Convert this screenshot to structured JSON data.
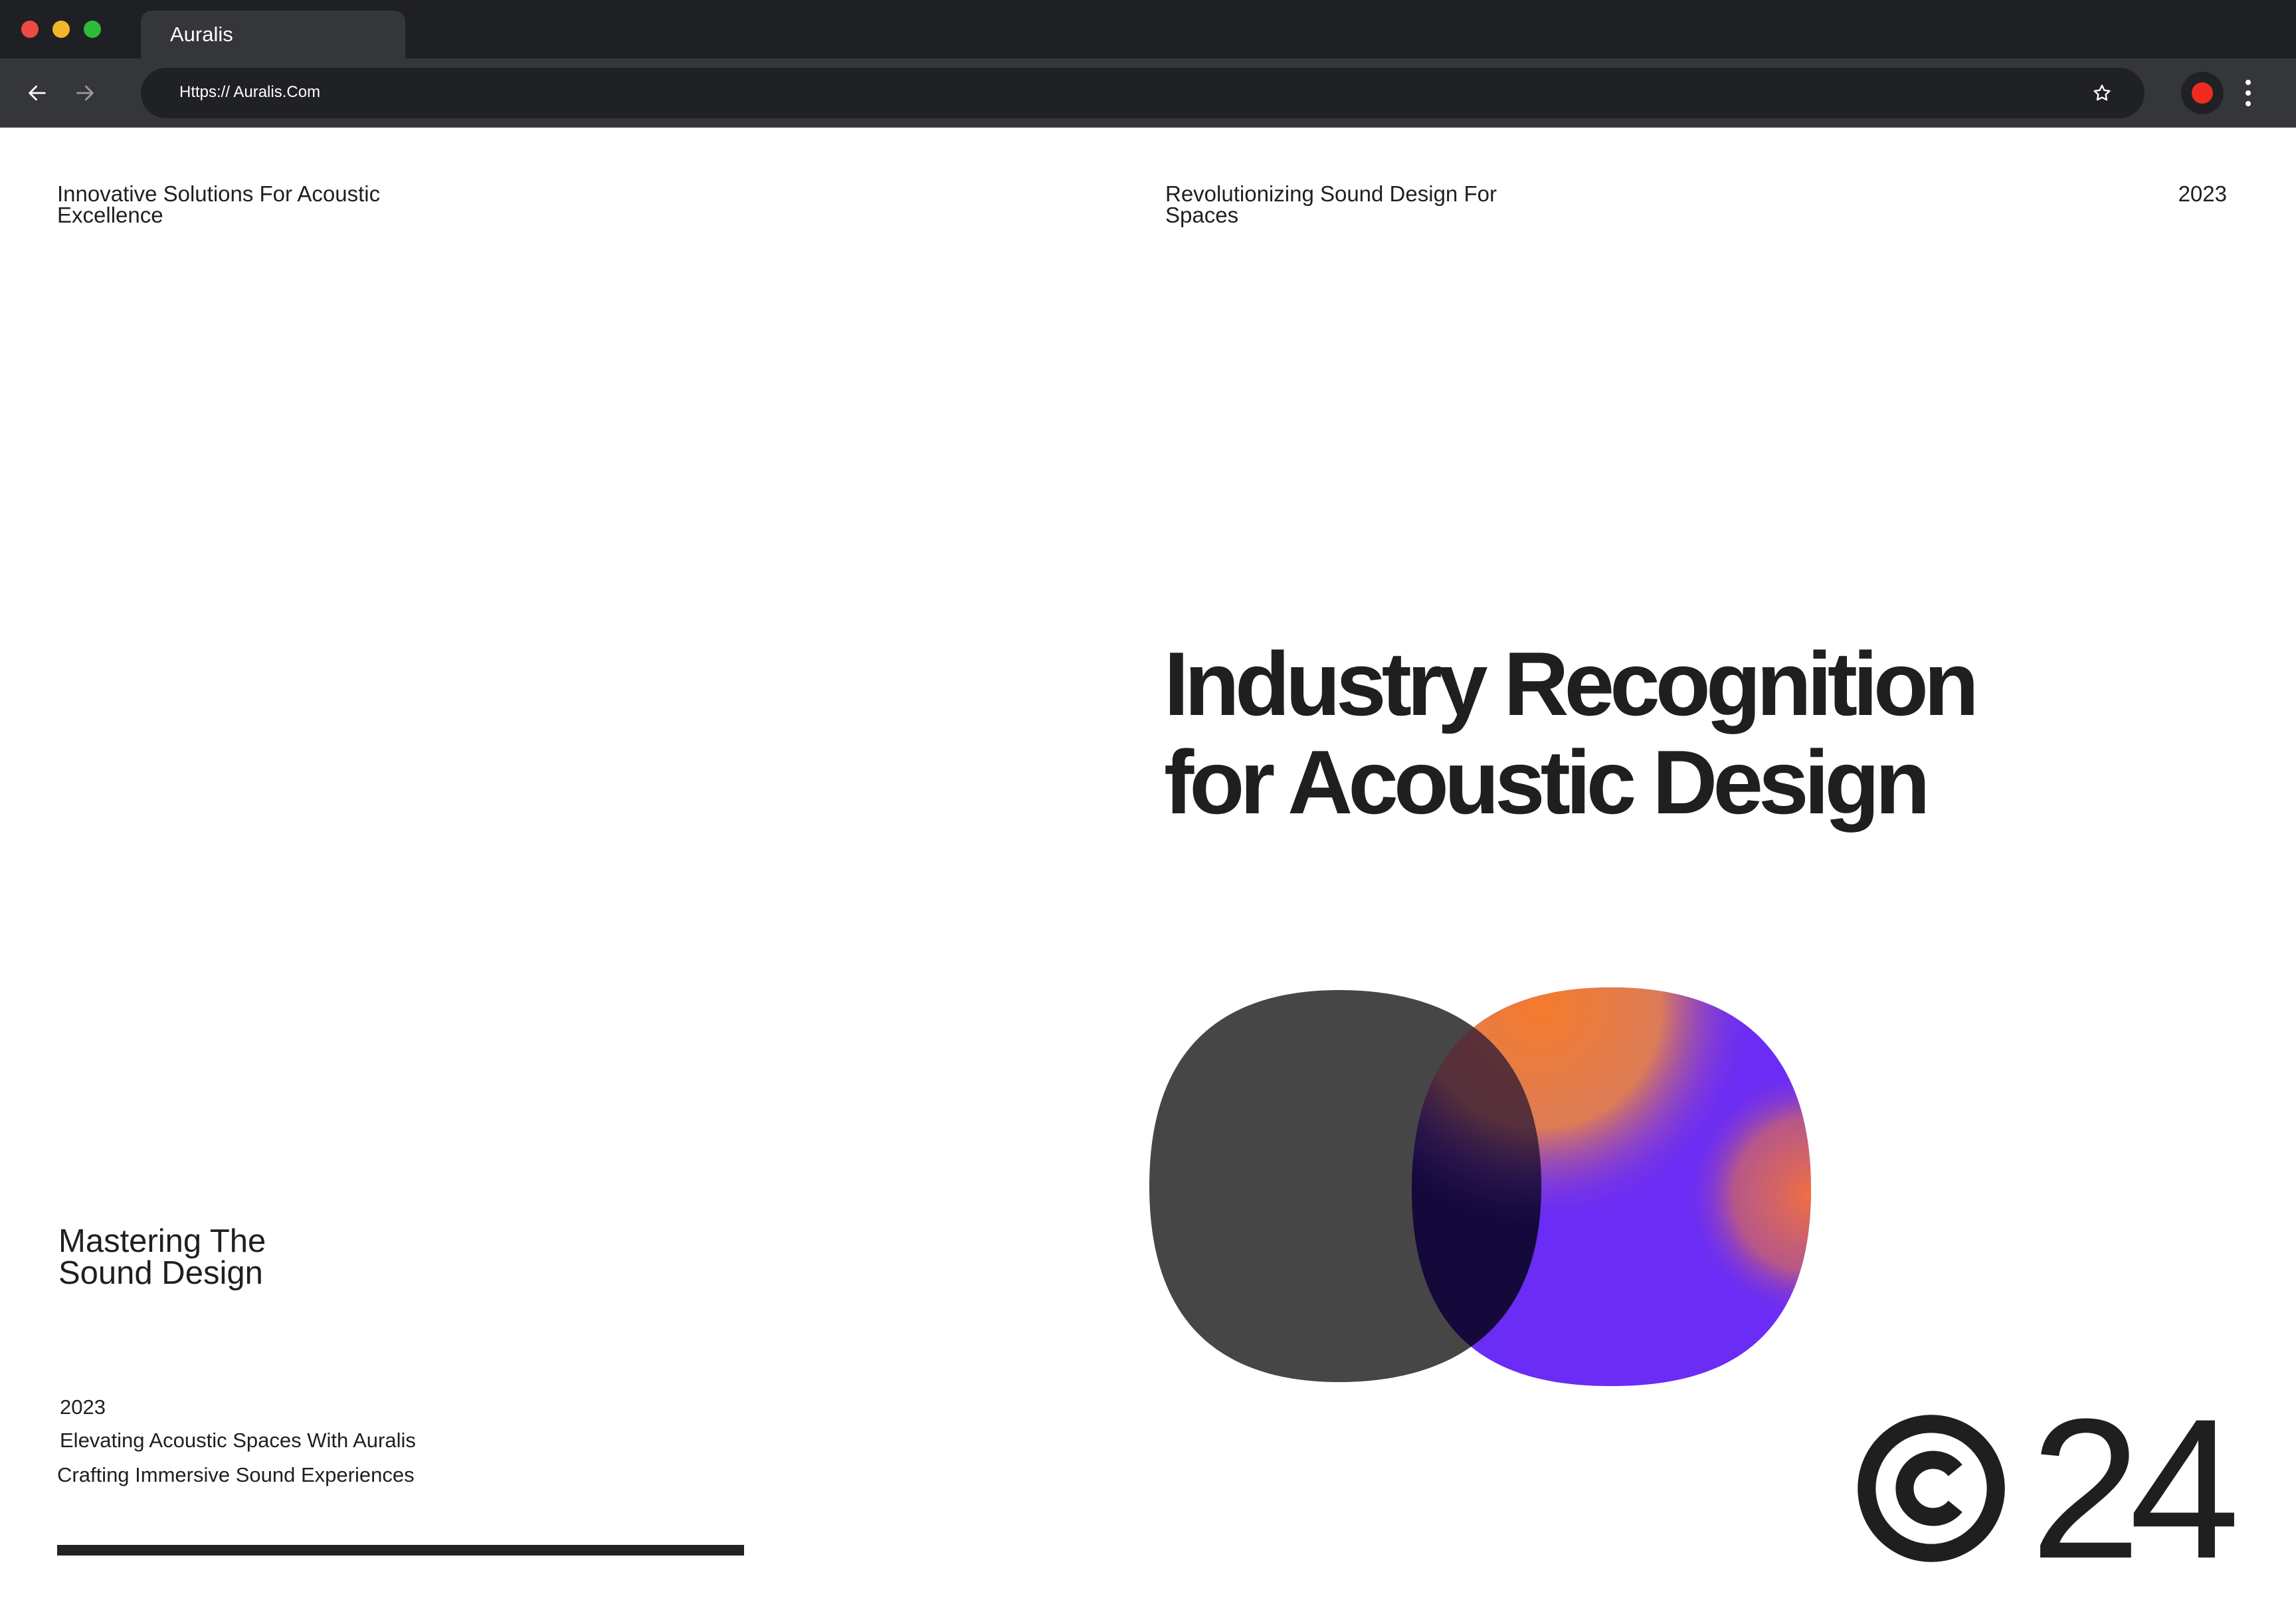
{
  "browser": {
    "tab_title": "Auralis",
    "url": "Https:// Auralis.Com",
    "icons": [
      "back-arrow-icon",
      "forward-arrow-icon",
      "star-icon",
      "extension-icon",
      "kebab-menu-icon"
    ]
  },
  "header": {
    "left_tagline": "Innovative Solutions For Acoustic Excellence",
    "center_tagline": "Revolutionizing Sound Design For Spaces",
    "year": "2023"
  },
  "hero": {
    "line1": "Industry Recognition",
    "line2": "for Acoustic Design"
  },
  "left_block": {
    "subhead_line1": "Mastering The",
    "subhead_line2": "Sound Design",
    "year": "2023",
    "line1": "Elevating Acoustic Spaces With Auralis",
    "line2": "Crafting Immersive Sound Experiences"
  },
  "footer": {
    "copyright_number": "24"
  },
  "colors": {
    "chrome_dark": "#1f2023",
    "chrome_bar": "#35363a",
    "text": "#1f1f1f",
    "shape_gray": "#464646",
    "shape_purple": "#6b2cf5",
    "shape_orange": "#f57a2b"
  }
}
